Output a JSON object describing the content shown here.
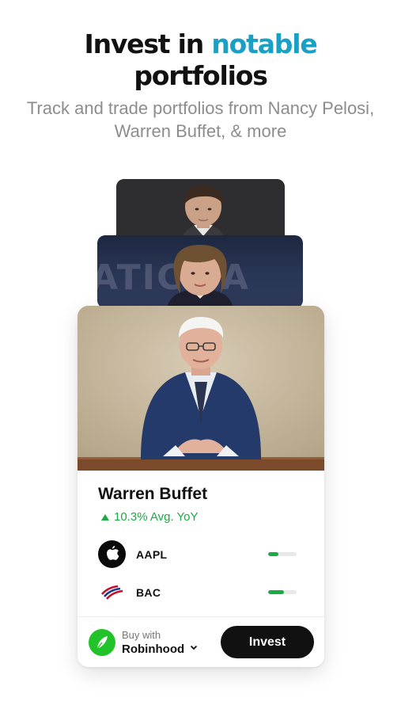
{
  "header": {
    "title_part1": "Invest in ",
    "title_accent": "notable",
    "title_part2": "portfolios",
    "subtitle": "Track and trade portfolios from Nancy Pelosi, Warren Buffet, & more",
    "accent_color": "#1aa0c4"
  },
  "cards_stack": {
    "back_card_1": {
      "icon": "person-portrait"
    },
    "back_card_2": {
      "icon": "person-portrait",
      "background_text": "ATIC PA"
    }
  },
  "featured_portfolio": {
    "name": "Warren Buffet",
    "performance": "10.3% Avg. YoY",
    "performance_color": "#1cab43",
    "holdings": [
      {
        "ticker": "AAPL",
        "icon": "apple-logo-icon",
        "weight": 0.35
      },
      {
        "ticker": "BAC",
        "icon": "bank-of-america-logo-icon",
        "weight": 0.55
      }
    ]
  },
  "footer": {
    "buy_with_label": "Buy with",
    "broker": "Robinhood",
    "broker_icon": "robinhood-feather-icon",
    "invest_label": "Invest"
  }
}
